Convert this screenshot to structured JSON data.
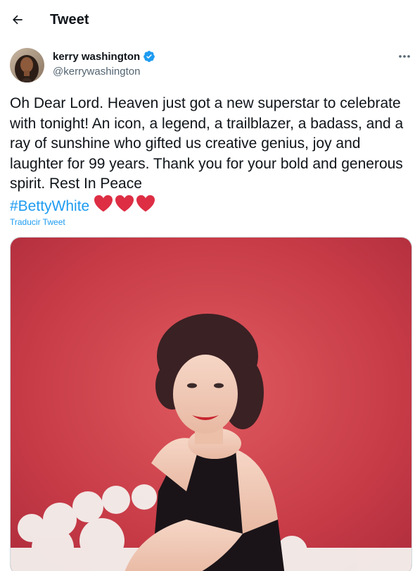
{
  "header": {
    "title": "Tweet",
    "back_icon": "arrow-left-icon"
  },
  "author": {
    "name": "kerry washington",
    "handle": "@kerrywashington",
    "verified_icon": "verified-badge-icon",
    "more_icon": "more-horizontal-icon"
  },
  "tweet": {
    "text": "Oh Dear Lord. Heaven just got a new superstar to celebrate with tonight! An icon, a legend, a trailblazer, a badass, and a ray of sunshine who gifted us creative genius, joy and laughter for 99 years. Thank you for your bold and generous spirit. Rest In Peace",
    "hashtag": "#BettyWhite",
    "emoji_icons": [
      "red-heart-icon",
      "red-heart-icon",
      "red-heart-icon"
    ],
    "translate_label": "Traducir Tweet"
  },
  "colors": {
    "accent": "#1d9bf0",
    "text_primary": "#0f1419",
    "text_secondary": "#536471",
    "heart": "#dd2e44"
  }
}
